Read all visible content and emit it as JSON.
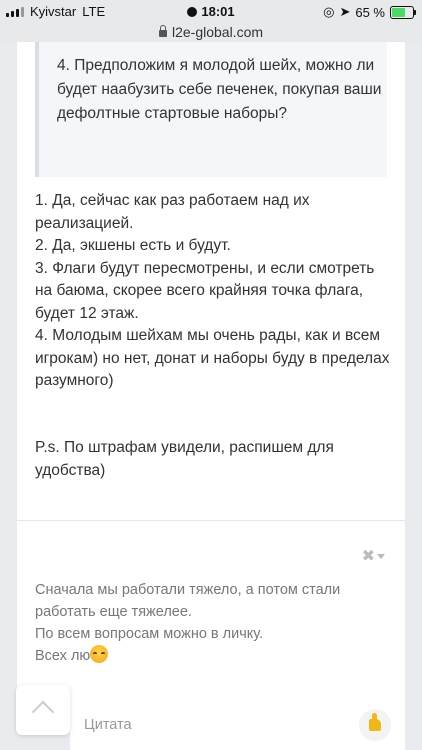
{
  "status_bar": {
    "carrier": "Kyivstar",
    "network": "LTE",
    "time": "18:01",
    "battery": "65 %",
    "battery_level": 0.65
  },
  "browser": {
    "url": "l2e-global.com"
  },
  "post": {
    "quote_text": "4. Предположим я молодой шейх, можно ли будет наабузить себе печенек, покупая ваши дефолтные стартовые наборы?",
    "answer_lines": [
      "1. Да, сейчас как раз работаем над их реализацией.",
      "2. Да, экшены есть и будут.",
      "3. Флаги будут пересмотрены, и если смотреть на баюма, скорее всего крайняя точка флага, будет 12 этаж.",
      "4. Молодым шейхам мы очень рады, как и всем игрокам)  но нет, донат и наборы буду в пределах разумного)"
    ],
    "ps_text": "P.s. По штрафам увидели, распишем для удобства)"
  },
  "signature": {
    "line1": "Сначала мы работали тяжело, а потом стали работать еще тяжелее.",
    "line2": "По всем вопросам можно в личку.",
    "line3": "Всех лю"
  },
  "bottom_bar": {
    "reply_label": "Цитата"
  }
}
